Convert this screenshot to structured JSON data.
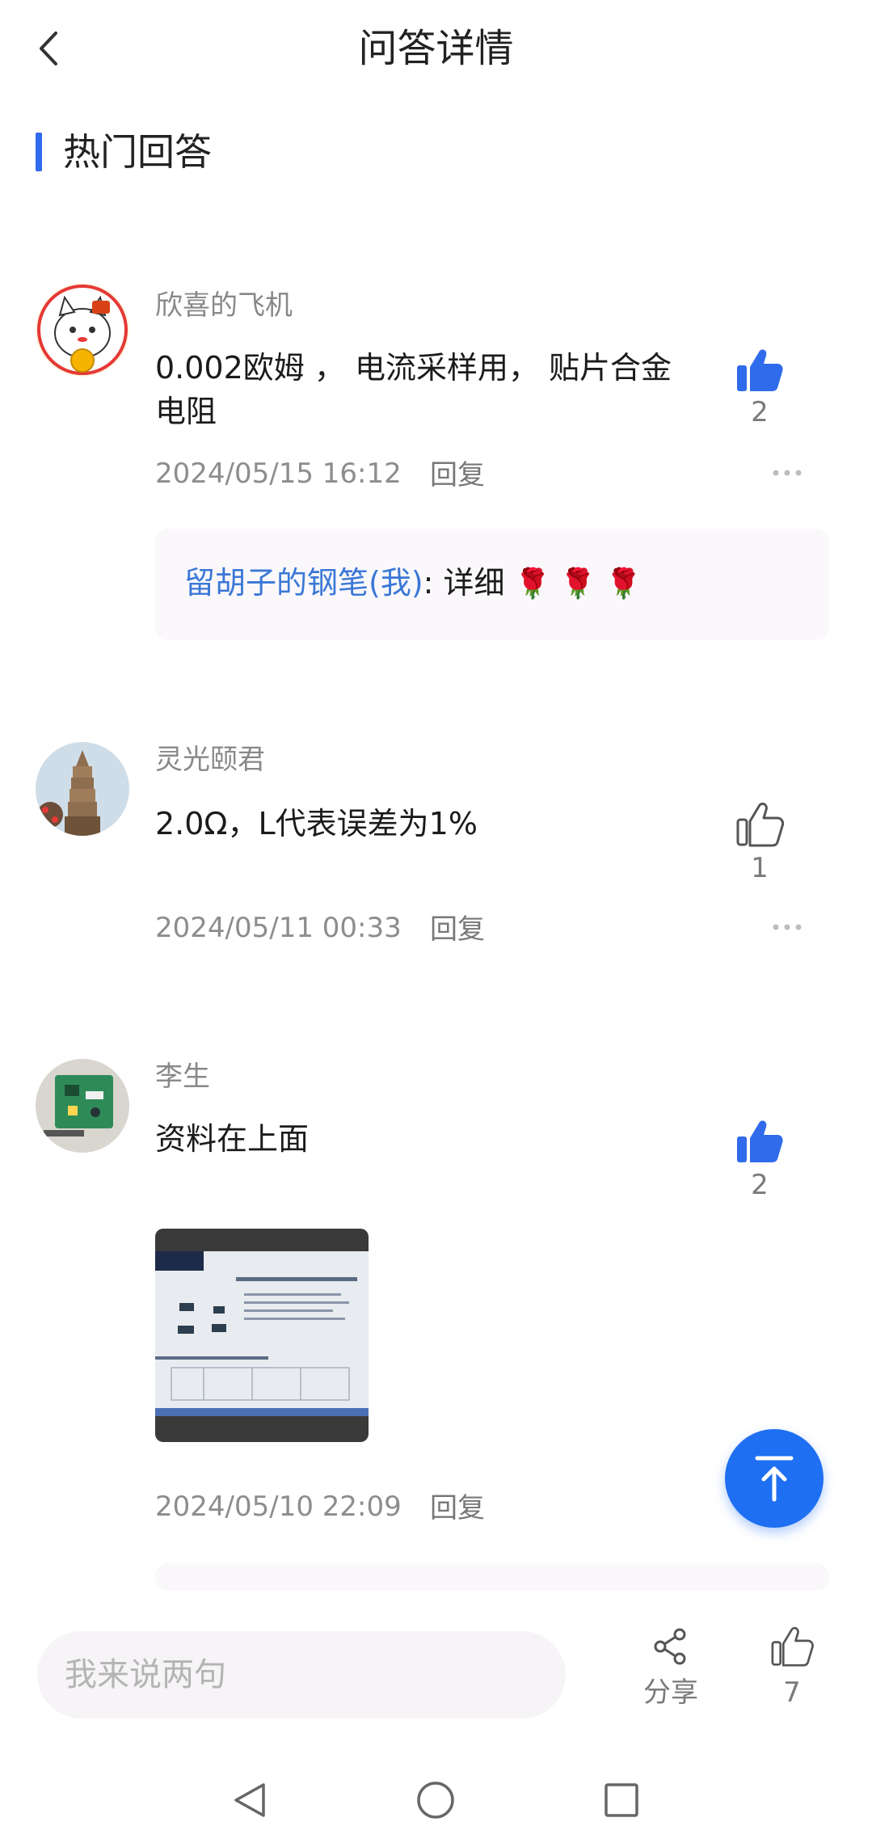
{
  "header": {
    "title": "问答详情",
    "back_icon": "chevron-left-icon"
  },
  "section": {
    "title": "热门回答",
    "accent_color": "#2f6bea"
  },
  "answers": [
    {
      "author": "欣喜的飞机",
      "content": "0.002欧姆 ， 电流采样用，  贴片合金电阻",
      "time": "2024/05/15 16:12",
      "reply_label": "回复",
      "likes": "2",
      "liked": true,
      "more_icon": "more-dots-icon",
      "replies": [
        {
          "name": "留胡子的钢笔(我)",
          "text": ": 详细",
          "emoji": "🌹 🌹 🌹"
        }
      ]
    },
    {
      "author": "灵光颐君",
      "content": "2.0Ω，L代表误差为1%",
      "time": "2024/05/11 00:33",
      "reply_label": "回复",
      "likes": "1",
      "liked": false,
      "more_icon": "more-dots-icon"
    },
    {
      "author": "李生",
      "content": "资料在上面",
      "time": "2024/05/10 22:09",
      "reply_label": "回复",
      "likes": "2",
      "liked": true,
      "attachment": "datasheet-photo"
    }
  ],
  "bottom_bar": {
    "input_placeholder": "我来说两句",
    "share_label": "分享",
    "like_count": "7"
  },
  "colors": {
    "liked_blue": "#2f6bea",
    "fab_blue": "#1f6ff2"
  }
}
